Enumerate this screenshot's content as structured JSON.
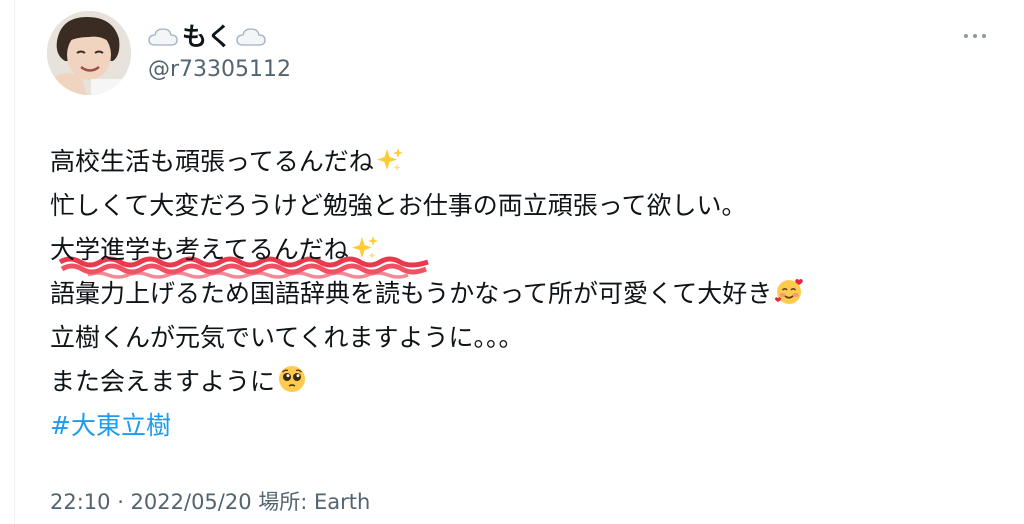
{
  "tweet": {
    "display_name": "もく",
    "handle": "@r73305112",
    "lines": [
      "高校生活も頑張ってるんだね",
      "忙しくて大変だろうけど勉強とお仕事の両立頑張って欲しい。",
      "大学進学も考えてるんだね",
      "語彙力上げるため国語辞典を読もうかなって所が可愛くて大好き",
      "立樹くんが元気でいてくれますように。。。",
      "また会えますように"
    ],
    "hashtag": "#大東立樹",
    "timestamp": "22:10 · 2022/05/20",
    "location_label": "場所: Earth"
  },
  "icons": {
    "cloud": "cloud-icon",
    "sparkles": "sparkles-emoji",
    "smiling_hearts": "smiling-face-with-hearts-emoji",
    "pleading": "pleading-face-emoji",
    "more": "more-options-icon"
  },
  "colors": {
    "text": "#0f1419",
    "secondary": "#536471",
    "link": "#1d9bf0",
    "highlight_underline": "#e8233a"
  }
}
